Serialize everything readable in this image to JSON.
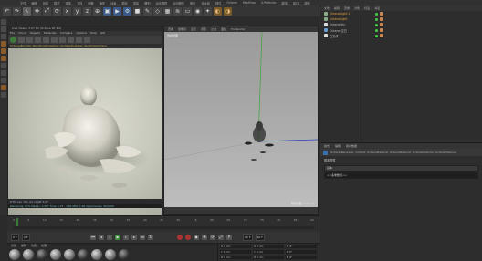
{
  "menu": [
    "文件",
    "编辑",
    "创建",
    "模式",
    "选择",
    "工具",
    "网格",
    "捕捉",
    "动画",
    "模拟",
    "渲染",
    "雕刻",
    "运动跟踪",
    "运动图形",
    "角色",
    "流水线",
    "插件",
    "Octane",
    "RealFlow",
    "X-Particles",
    "脚本",
    "窗口",
    "帮助"
  ],
  "octane": {
    "title": "Live Viewer 2.07 R2 (Octane RT 4.0)",
    "menu": [
      "File",
      "Cloud",
      "Objects",
      "Materials",
      "Compare",
      "Options",
      "Help",
      "GUI"
    ],
    "path": "Octane/Ben/Ven Ben/Dow/Dow/Dow Update/Dow/Ben Ven/Dow/Octane",
    "status": "DTM ven 761 (2)       10GB       3.0T",
    "status2": "Rendering: 97%  Ms/sec: 3.457   Time: 1.07 : 1.00  GPU: 1.00  Spp/maxspp: 99/1000"
  },
  "viewport": {
    "menu": [
      "查看",
      "摄像机",
      "显示",
      "选项",
      "过滤",
      "面板",
      "ProRender"
    ],
    "label": "透视视图",
    "footer": "网格间距: 100 cm"
  },
  "objects": {
    "header": [
      "文件",
      "编辑",
      "查看",
      "对象",
      "标签",
      "书签"
    ],
    "rows": [
      {
        "label": "OctaneLight.1",
        "color": "orange"
      },
      {
        "label": "OctaneLight",
        "color": "orange"
      },
      {
        "label": "OctaneSky",
        "color": "white"
      },
      {
        "label": "Octane 空白",
        "color": "blue"
      },
      {
        "label": "立方体",
        "color": "white"
      }
    ]
  },
  "attributes": {
    "tabs": [
      "模式",
      "编辑",
      "用户数据"
    ],
    "toolbar": "Octane Renderer, OctMat, OctaneMaterial, OctaneMaterial, OctaneMaterial, OctaneMaterial",
    "section": "基本属性",
    "field1": "基本",
    "field2": "<<多重数值>>"
  },
  "timeline": {
    "ticks": [
      "0",
      "5",
      "10",
      "15",
      "20",
      "25",
      "30",
      "35",
      "40",
      "45",
      "50",
      "55",
      "60",
      "65",
      "70",
      "75",
      "80",
      "85",
      "90"
    ],
    "playhead_frame": 0
  },
  "transport": {
    "start": "0 F",
    "current": "0 F",
    "end": "90 F",
    "end2": "90 F"
  },
  "materials": {
    "header": [
      "创建",
      "编辑",
      "功能",
      "纹理"
    ],
    "count": 9
  },
  "coords": {
    "rows": [
      [
        "X  0 cm",
        "X  0 cm",
        "H  0°"
      ],
      [
        "Y  0 cm",
        "Y  0 cm",
        "P  0°"
      ],
      [
        "Z  0 cm",
        "Z  0 cm",
        "B  0°"
      ]
    ]
  }
}
